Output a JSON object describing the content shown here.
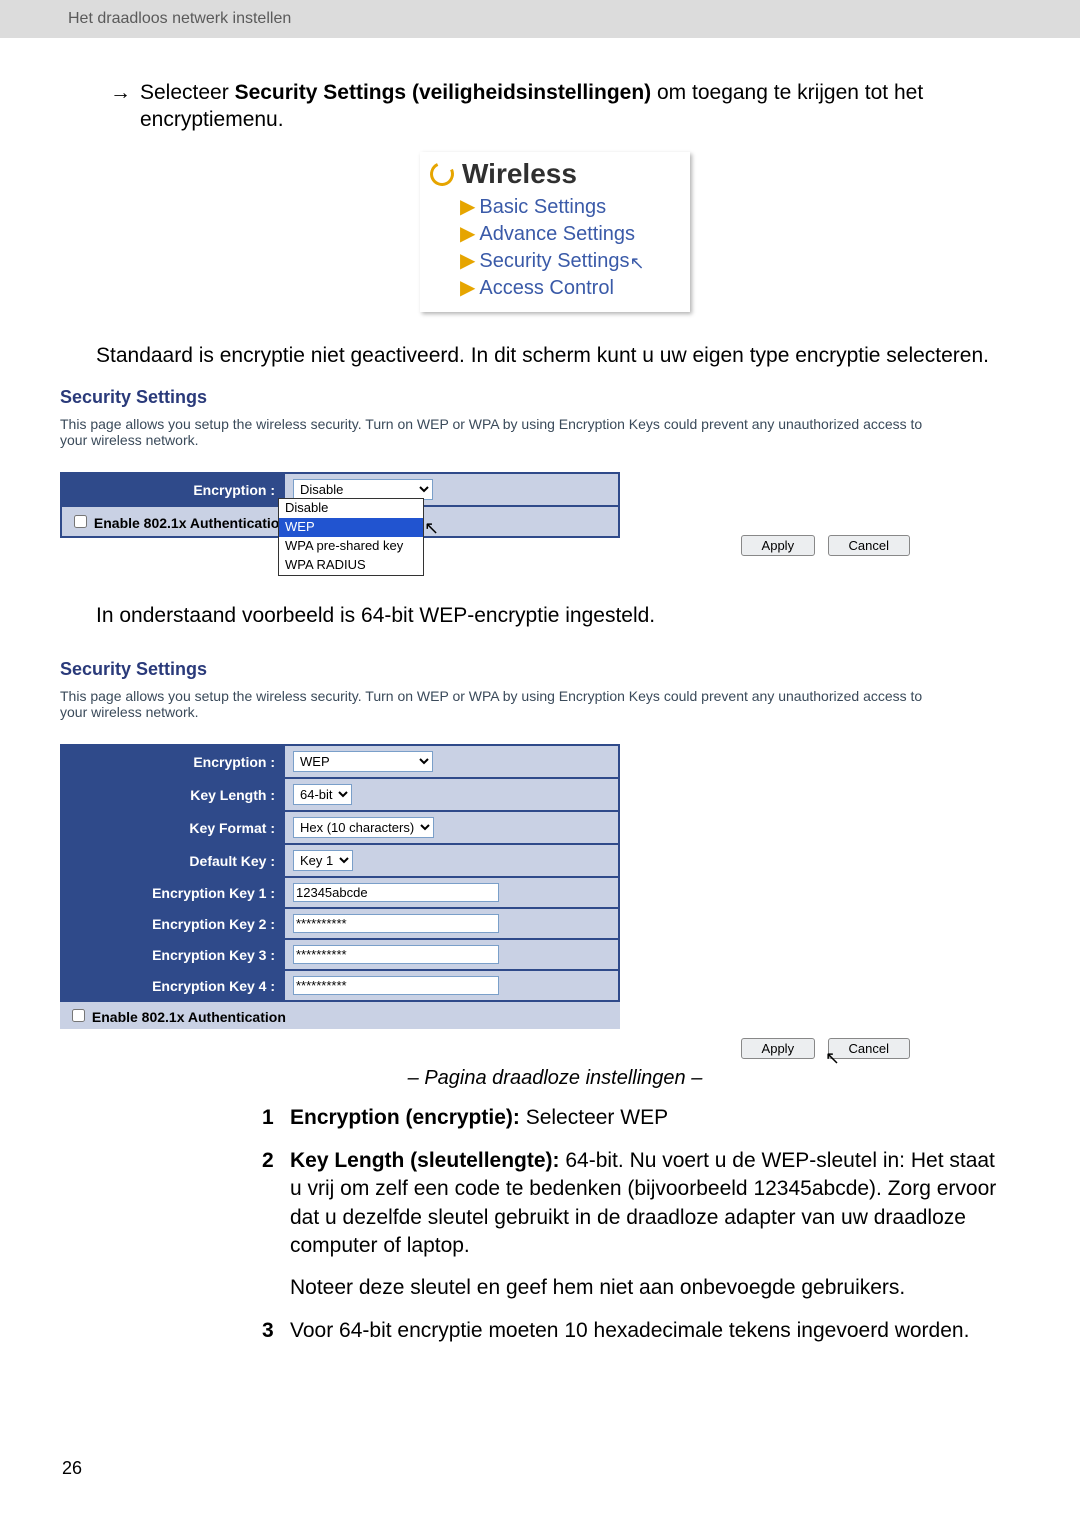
{
  "header": {
    "breadcrumb": "Het draadloos netwerk instellen"
  },
  "intro": {
    "line1_prefix": "Selecteer ",
    "line1_bold": "Security Settings (veiligheidsinstellingen)",
    "line1_suffix": " om toegang te krijgen tot het encryptiemenu.",
    "middle": "Standaard is encryptie niet geactiveerd. In dit scherm kunt u uw eigen type encryptie selecteren.",
    "below": "In onderstaand voorbeeld is 64-bit WEP-encryptie ingesteld."
  },
  "wireless_menu": {
    "title": "Wireless",
    "items": [
      "Basic Settings",
      "Advance Settings",
      "Security Settings",
      "Access Control"
    ]
  },
  "sec1": {
    "title": "Security Settings",
    "desc": "This page allows you setup the wireless security. Turn on WEP or WPA by using Encryption Keys could prevent any unauthorized access to your wireless network.",
    "encryption_label": "Encryption :",
    "encryption_value": "Disable",
    "dropdown_options": [
      "Disable",
      "WEP",
      "WPA pre-shared key",
      "WPA RADIUS"
    ],
    "dropdown_highlight": "WEP",
    "enable_8021x_label": "Enable 802.1x Authentication",
    "apply": "Apply",
    "cancel": "Cancel"
  },
  "sec2": {
    "title": "Security Settings",
    "desc": "This page allows you setup the wireless security. Turn on WEP or WPA by using Encryption Keys could prevent any unauthorized access to your wireless network.",
    "rows": {
      "encryption": {
        "label": "Encryption :",
        "value": "WEP"
      },
      "key_length": {
        "label": "Key Length :",
        "value": "64-bit"
      },
      "key_format": {
        "label": "Key Format :",
        "value": "Hex (10 characters)"
      },
      "default_key": {
        "label": "Default Key :",
        "value": "Key 1"
      },
      "k1": {
        "label": "Encryption Key 1 :",
        "value": "12345abcde"
      },
      "k2": {
        "label": "Encryption Key 2 :",
        "value": "**********"
      },
      "k3": {
        "label": "Encryption Key 3 :",
        "value": "**********"
      },
      "k4": {
        "label": "Encryption Key 4 :",
        "value": "**********"
      }
    },
    "enable_8021x_label": "Enable 802.1x Authentication",
    "apply": "Apply",
    "cancel": "Cancel"
  },
  "caption": "– Pagina draadloze instellingen –",
  "steps": {
    "s1_bold": "Encryption (encryptie):",
    "s1_rest": " Selecteer WEP",
    "s2_bold": "Key Length (sleutellengte):",
    "s2_rest": " 64-bit. Nu voert u de WEP-sleutel in: Het staat u vrij om zelf een code te bedenken (bijvoorbeeld 12345abcde). Zorg ervoor dat u dezelfde sleutel gebruikt in de draadloze adapter van uw draadloze computer of laptop.",
    "s2_note": "Noteer deze sleutel en geef hem niet aan onbevoegde gebruikers.",
    "s3": "Voor 64-bit encryptie moeten 10 hexadecimale tekens ingevoerd worden."
  },
  "page_number": "26"
}
